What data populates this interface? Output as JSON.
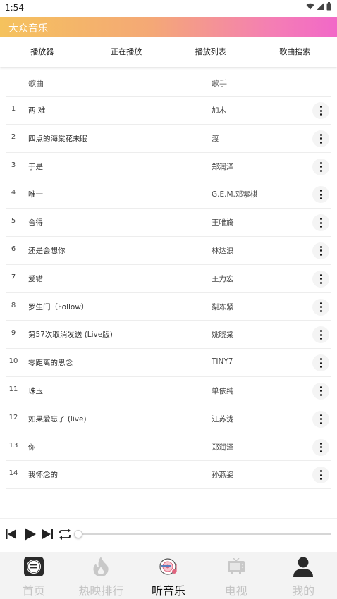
{
  "status_bar": {
    "time": "1:54",
    "icons": [
      "wifi-icon",
      "signal-icon",
      "battery-icon"
    ]
  },
  "app_bar": {
    "title": "大众音乐",
    "gradient": [
      "#f5c25d",
      "#f268c8"
    ]
  },
  "tabs": [
    {
      "label": "播放器"
    },
    {
      "label": "正在播放"
    },
    {
      "label": "播放列表"
    },
    {
      "label": "歌曲搜索"
    }
  ],
  "list_header": {
    "song": "歌曲",
    "artist": "歌手"
  },
  "songs": [
    {
      "index": "1",
      "title": "两 难",
      "artist": "加木"
    },
    {
      "index": "2",
      "title": "四点的海棠花未眠",
      "artist": "渡"
    },
    {
      "index": "3",
      "title": "于是",
      "artist": "郑润泽"
    },
    {
      "index": "4",
      "title": "唯一",
      "artist": "G.E.M.邓紫棋"
    },
    {
      "index": "5",
      "title": "舍得",
      "artist": "王唯旖"
    },
    {
      "index": "6",
      "title": "还是会想你",
      "artist": "林达浪"
    },
    {
      "index": "7",
      "title": "爱错",
      "artist": "王力宏"
    },
    {
      "index": "8",
      "title": "罗生门（Follow）",
      "artist": "梨冻紧"
    },
    {
      "index": "9",
      "title": "第57次取消发送 (Live版)",
      "artist": "姚晓棠"
    },
    {
      "index": "10",
      "title": "零距离的思念",
      "artist": "TINY7"
    },
    {
      "index": "11",
      "title": "珠玉",
      "artist": "单依纯"
    },
    {
      "index": "12",
      "title": "如果爱忘了 (live)",
      "artist": "汪苏泷"
    },
    {
      "index": "13",
      "title": "你",
      "artist": "郑润泽"
    },
    {
      "index": "14",
      "title": "我怀念的",
      "artist": "孙燕姿"
    }
  ],
  "player": {
    "controls": [
      "previous-icon",
      "play-icon",
      "next-icon",
      "repeat-icon"
    ],
    "progress": 0
  },
  "bottom_nav": [
    {
      "label": "首页",
      "icon": "home-logo-icon",
      "active": false
    },
    {
      "label": "热映排行",
      "icon": "flame-icon",
      "active": false
    },
    {
      "label": "听音乐",
      "icon": "music-disc-icon",
      "active": true
    },
    {
      "label": "电视",
      "icon": "tv-icon",
      "active": false
    },
    {
      "label": "我的",
      "icon": "user-icon",
      "active": false
    }
  ],
  "colors": {
    "active_nav": "#111111",
    "inactive_nav": "#c4c4c4",
    "nav_background": "#f3f3f3"
  }
}
